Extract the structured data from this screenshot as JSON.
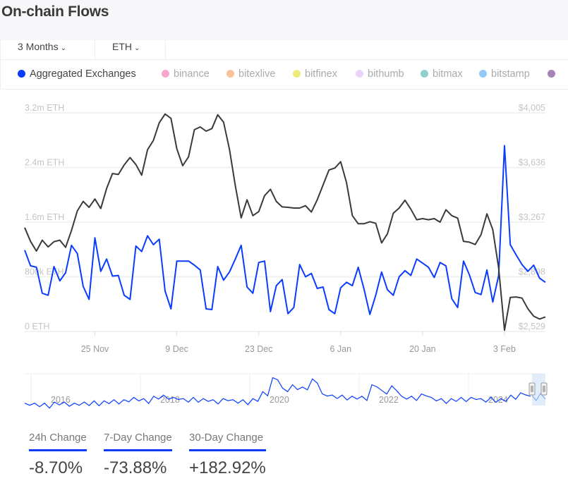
{
  "header": {
    "title": "On-chain Flows"
  },
  "controls": {
    "period": "3 Months",
    "asset": "ETH",
    "chevron": "⌄"
  },
  "legend": [
    {
      "label": "Aggregated Exchanges",
      "color": "#0a3cff",
      "active": true
    },
    {
      "label": "binance",
      "color": "#f9a6cf"
    },
    {
      "label": "bitexlive",
      "color": "#fbc29a"
    },
    {
      "label": "bitfinex",
      "color": "#eeea7c"
    },
    {
      "label": "bithumb",
      "color": "#ebd3fb"
    },
    {
      "label": "bitmax",
      "color": "#8fd0cc"
    },
    {
      "label": "bitstamp",
      "color": "#94c9f7"
    },
    {
      "label": "",
      "color": "#a783b6"
    }
  ],
  "chart_data": {
    "type": "line",
    "left_axis": {
      "ticks": [
        "0 ETH",
        "800k ETH",
        "1.6m ETH",
        "2.4m ETH",
        "3.2m ETH"
      ],
      "range_m": [
        0,
        3.2
      ]
    },
    "right_axis": {
      "ticks": [
        "$2,529",
        "$2,898",
        "$3,267",
        "$3,636",
        "$4,005"
      ],
      "range": [
        2529,
        4005
      ]
    },
    "x_ticks": [
      "25 Nov",
      "9 Dec",
      "23 Dec",
      "6 Jan",
      "20 Jan",
      "3 Feb"
    ],
    "grid": true,
    "x": [
      "13 Nov",
      "14 Nov",
      "15 Nov",
      "16 Nov",
      "17 Nov",
      "18 Nov",
      "19 Nov",
      "20 Nov",
      "21 Nov",
      "22 Nov",
      "23 Nov",
      "24 Nov",
      "25 Nov",
      "26 Nov",
      "27 Nov",
      "28 Nov",
      "29 Nov",
      "30 Nov",
      "1 Dec",
      "2 Dec",
      "3 Dec",
      "4 Dec",
      "5 Dec",
      "6 Dec",
      "7 Dec",
      "8 Dec",
      "9 Dec",
      "10 Dec",
      "11 Dec",
      "12 Dec",
      "13 Dec",
      "14 Dec",
      "15 Dec",
      "16 Dec",
      "17 Dec",
      "18 Dec",
      "19 Dec",
      "20 Dec",
      "21 Dec",
      "22 Dec",
      "23 Dec",
      "24 Dec",
      "25 Dec",
      "26 Dec",
      "27 Dec",
      "28 Dec",
      "29 Dec",
      "30 Dec",
      "31 Dec",
      "1 Jan",
      "2 Jan",
      "3 Jan",
      "4 Jan",
      "5 Jan",
      "6 Jan",
      "7 Jan",
      "8 Jan",
      "9 Jan",
      "10 Jan",
      "11 Jan",
      "12 Jan",
      "13 Jan",
      "14 Jan",
      "15 Jan",
      "16 Jan",
      "17 Jan",
      "18 Jan",
      "19 Jan",
      "20 Jan",
      "21 Jan",
      "22 Jan",
      "23 Jan",
      "24 Jan",
      "25 Jan",
      "26 Jan",
      "27 Jan",
      "28 Jan",
      "29 Jan",
      "30 Jan",
      "31 Jan",
      "1 Feb",
      "2 Feb",
      "3 Feb",
      "4 Feb",
      "5 Feb",
      "6 Feb",
      "7 Feb",
      "8 Feb",
      "9 Feb",
      "10 Feb"
    ],
    "series": [
      {
        "name": "Aggregated Exchanges",
        "axis": "left",
        "unit": "m ETH",
        "color": "#0a3cff",
        "values": [
          1.19,
          0.96,
          0.94,
          0.56,
          0.53,
          0.95,
          0.74,
          0.86,
          1.26,
          1.14,
          0.66,
          0.47,
          1.37,
          0.88,
          1.06,
          0.81,
          0.82,
          0.53,
          0.47,
          1.25,
          1.17,
          1.4,
          1.27,
          1.35,
          0.59,
          0.33,
          1.03,
          1.03,
          1.03,
          0.97,
          0.9,
          0.33,
          0.32,
          0.95,
          0.75,
          0.87,
          1.06,
          1.26,
          0.65,
          0.56,
          1.01,
          1.03,
          0.29,
          0.67,
          0.76,
          0.26,
          0.35,
          0.98,
          0.8,
          0.85,
          0.63,
          0.65,
          0.32,
          0.26,
          0.64,
          0.72,
          0.67,
          0.94,
          0.62,
          0.25,
          0.53,
          0.87,
          0.61,
          0.53,
          0.8,
          0.89,
          0.82,
          1.06,
          1.0,
          0.94,
          0.79,
          1.01,
          0.96,
          0.48,
          0.35,
          1.03,
          0.83,
          0.57,
          0.54,
          0.9,
          0.43,
          0.82,
          2.72,
          1.27,
          1.12,
          0.98,
          0.88,
          0.97,
          0.78,
          0.72
        ]
      },
      {
        "axis": "right",
        "unit": "USD",
        "color": "#3a3a3a",
        "values": [
          3230,
          3137,
          3072,
          3145,
          3100,
          3135,
          3145,
          3097,
          3211,
          3343,
          3407,
          3367,
          3423,
          3359,
          3494,
          3595,
          3589,
          3653,
          3703,
          3656,
          3584,
          3756,
          3819,
          3938,
          3997,
          3968,
          3762,
          3648,
          3708,
          3891,
          3910,
          3881,
          3899,
          3992,
          3941,
          3759,
          3513,
          3296,
          3418,
          3311,
          3338,
          3446,
          3489,
          3407,
          3370,
          3367,
          3362,
          3362,
          3378,
          3335,
          3418,
          3518,
          3619,
          3632,
          3675,
          3534,
          3311,
          3256,
          3256,
          3270,
          3259,
          3127,
          3188,
          3327,
          3362,
          3415,
          3354,
          3283,
          3291,
          3283,
          3291,
          3267,
          3351,
          3311,
          3294,
          3137,
          3132,
          3116,
          3183,
          3323,
          3216,
          2958,
          2537,
          2759,
          2762,
          2754,
          2683,
          2632,
          2613,
          2627
        ]
      }
    ],
    "navigator": {
      "years": [
        "2016",
        "2018",
        "2020",
        "2022",
        "2024"
      ],
      "values": [
        0.2,
        0.2,
        0.2,
        0.3,
        0.3,
        0.2,
        0.3,
        0.4,
        0.4,
        0.5,
        0.5,
        0.7,
        0.6,
        0.8,
        0.9,
        0.7,
        0.6,
        0.7,
        0.6,
        0.5,
        0.6,
        0.5,
        0.5,
        0.6,
        1.2,
        2.4,
        1.5,
        1.8,
        1.6,
        2.3,
        1.0,
        0.9,
        0.9,
        0.8,
        0.8,
        1.8,
        1.3,
        1.7,
        0.8,
        0.8,
        1.0,
        0.7,
        0.6,
        0.6,
        0.7,
        0.7,
        0.6,
        0.7,
        0.6,
        0.9,
        1.1,
        0.8
      ]
    }
  },
  "stats": [
    {
      "label": "24h Change",
      "value": "-8.70%"
    },
    {
      "label": "7-Day Change",
      "value": "-73.88%"
    },
    {
      "label": "30-Day Change",
      "value": "+182.92%"
    }
  ]
}
